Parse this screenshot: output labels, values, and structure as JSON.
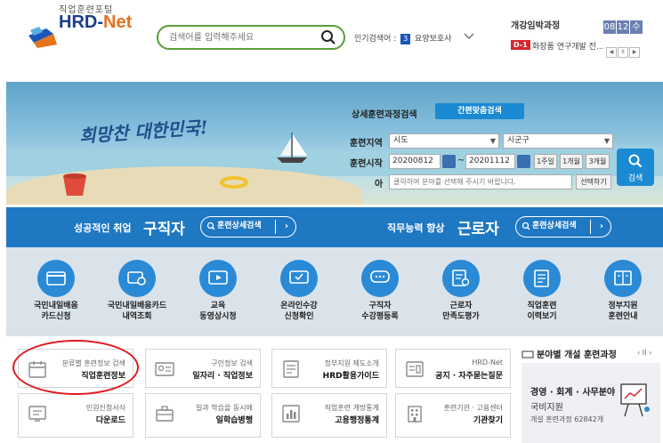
{
  "header": {
    "logo_small": "직업훈련포털",
    "logo_main": "HRD-",
    "logo_net": "Net",
    "search_placeholder": "검색어를 입력해주세요",
    "popular_label": "인기검색어 :",
    "popular_rank": "3",
    "popular_term": "요양보호사",
    "course_title": "개강임박과정",
    "date": [
      "08",
      "12",
      "수"
    ],
    "dday": "D-1",
    "dday_text": "화장품 연구개발 전..."
  },
  "banner": {
    "script": "희망찬 대한민국!",
    "form": {
      "title": "상세훈련과정검색",
      "simple_btn": "간편맞춤검색",
      "region_label": "훈련지역",
      "region_value": "시도",
      "district_value": "시군구",
      "start_label": "훈련시작",
      "date_from": "20200812",
      "date_sep": "~",
      "date_to": "20201112",
      "period_buttons": [
        "1주일",
        "1개월",
        "3개월"
      ],
      "field_label": "아",
      "field_placeholder": "클릭하여 분야를 선택해 주시기 바랍니다.",
      "field_btn": "선택하기",
      "search_btn": "검색"
    }
  },
  "bluebar": {
    "left_sub": "성공적인 취업",
    "left_big": "구직자",
    "left_btn": "훈련상세검색",
    "right_sub": "직무능력 향상",
    "right_big": "근로자",
    "right_btn": "훈련상세검색"
  },
  "icons": [
    {
      "line1": "국민내일배움",
      "line2": "카드신청",
      "icon": "card-icon"
    },
    {
      "line1": "국민내일배움카드",
      "line2": "내역조회",
      "icon": "card-search-icon"
    },
    {
      "line1": "교육",
      "line2": "동영상시청",
      "icon": "video-icon"
    },
    {
      "line1": "온라인수강",
      "line2": "신청확인",
      "icon": "monitor-check-icon"
    },
    {
      "line1": "구직자",
      "line2": "수강평등록",
      "icon": "chat-icon"
    },
    {
      "line1": "근로자",
      "line2": "만족도평가",
      "icon": "survey-icon"
    },
    {
      "line1": "직업훈련",
      "line2": "이력보기",
      "icon": "history-icon"
    },
    {
      "line1": "정부지원",
      "line2": "훈련안내",
      "icon": "book-icon"
    }
  ],
  "cards_row1": [
    {
      "t1": "분류별 훈련정보 검색",
      "t2": "직업훈련정보",
      "icon": "calendar-icon"
    },
    {
      "t1": "구인정보 검색",
      "t2": "일자리 · 직업정보",
      "icon": "id-card-icon"
    },
    {
      "t1": "정부지원 제도소개",
      "t2": "HRD활용가이드",
      "icon": "document-icon"
    },
    {
      "t1": "HRD-Net",
      "t2": "공지 · 자주묻는질문",
      "icon": "notice-icon"
    }
  ],
  "cards_row2": [
    {
      "t1": "민원신청서식",
      "t2": "다운로드",
      "icon": "form-icon"
    },
    {
      "t1": "일과 학습을 동시에",
      "t2": "일학습병행",
      "icon": "briefcase-icon"
    },
    {
      "t1": "직업훈련 개방통계",
      "t2": "고용행정통계",
      "icon": "chart-icon"
    },
    {
      "t1": "훈련기관 · 고용센터",
      "t2": "기관찾기",
      "icon": "building-icon"
    }
  ],
  "right_panel": {
    "title": "분야별 개설 훈련과정",
    "ctrl": "‹ II ›",
    "main": "경영 · 회계 · 사무분야",
    "sub": "국비지원",
    "count": "개설 훈련과정 62842개"
  }
}
